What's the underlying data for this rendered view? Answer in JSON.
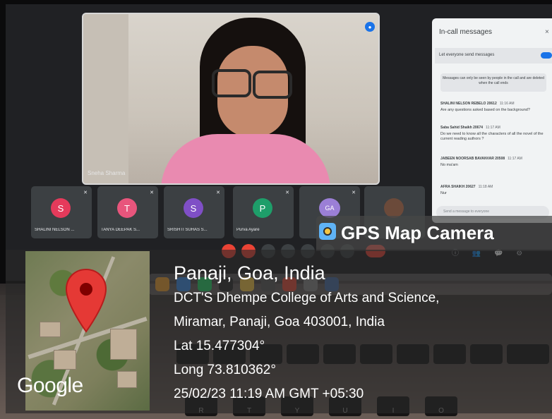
{
  "meet": {
    "main_speaker_name": "Sneha Sharma",
    "participants": [
      {
        "name": "SHALINI NELSON ...",
        "initial": "S",
        "color": "#e53a5b"
      },
      {
        "name": "TANYA DEEPAK S...",
        "initial": "T",
        "color": "#e8557c"
      },
      {
        "name": "SRISHTI SUHAS S...",
        "initial": "S",
        "color": "#7f4fc6"
      },
      {
        "name": "Purva Ayare",
        "initial": "P",
        "color": "#1e9e6a"
      },
      {
        "name": "",
        "initial": "GA",
        "color": "#9b7fd6"
      }
    ]
  },
  "chat": {
    "title": "In-call messages",
    "close": "×",
    "toggle_label": "Let everyone send messages",
    "note": "Messages can only be seen by people in the call and are deleted when the call ends",
    "messages": [
      {
        "sender": "SHALINI NELSON REBELO 20612",
        "time": "11:16 AM",
        "text": "Are any questions asked based on the background?"
      },
      {
        "sender": "Saba Sahid Shaikh 20674",
        "time": "11:17 AM",
        "text": "Do we need to know all the characters of all the novel of the current reading authors ?"
      },
      {
        "sender": "JABEEN NOORSAB BAVANVAR 20508",
        "time": "11:17 AM",
        "text": "No ma'am"
      },
      {
        "sender": "AFRA SHAIKH 20627",
        "time": "11:18 AM",
        "text": "Nur"
      }
    ],
    "input_placeholder": "Send a message to everyone"
  },
  "gps": {
    "app_name": "GPS Map Camera",
    "location_title": "Panaji, Goa, India",
    "address_line1": "DCT'S Dhempe College of Arts and Science,",
    "address_line2": "Miramar, Panaji, Goa 403001, India",
    "latitude": "Lat 15.477304°",
    "longitude": "Long 73.810362°",
    "datetime": "25/02/23 11:19 AM GMT +05:30",
    "map_brand": "Google"
  },
  "keyboard": {
    "keys": [
      "R",
      "T",
      "Y",
      "U",
      "I",
      "O"
    ]
  },
  "colors": {
    "accent": "#1a73e8",
    "end_call": "#ea4335",
    "pin": "#e53935"
  }
}
